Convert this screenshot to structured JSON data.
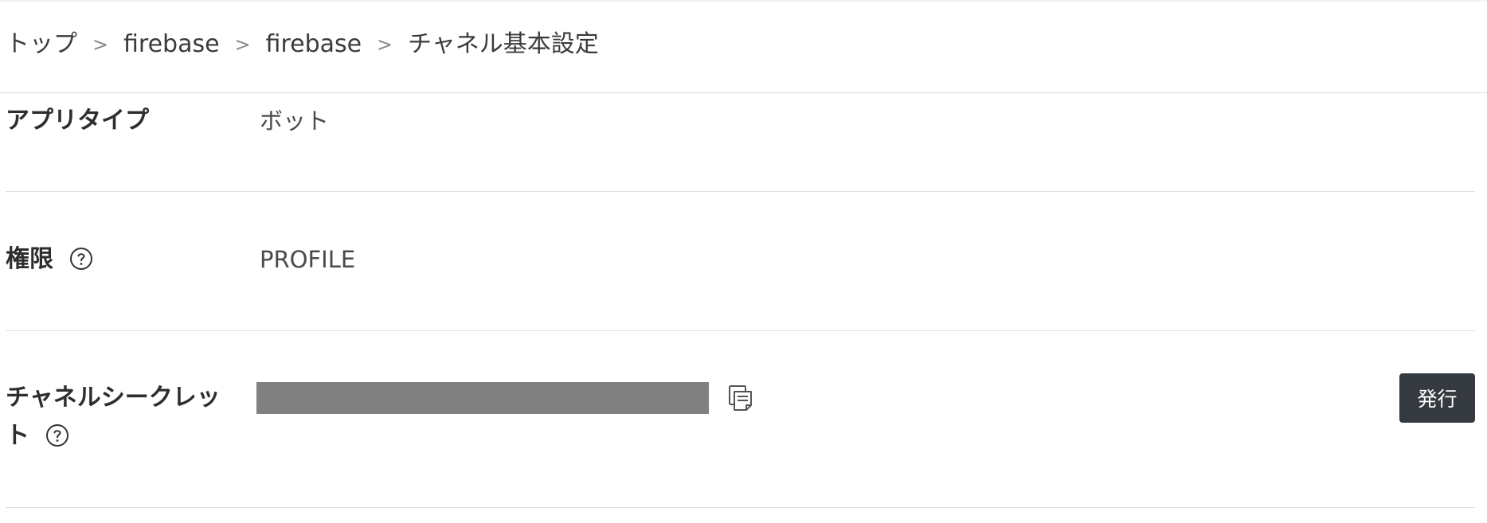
{
  "breadcrumb": {
    "items": [
      "トップ",
      "firebase",
      "firebase",
      "チャネル基本設定"
    ],
    "separator": ">"
  },
  "settings": {
    "app_type": {
      "label": "アプリタイプ",
      "value": "ボット"
    },
    "permission": {
      "label": "権限",
      "value": "PROFILE",
      "help_icon": "question-circle-icon"
    },
    "channel_secret": {
      "label_line1": "チャネルシークレッ",
      "label_line2": "ト",
      "help_icon": "question-circle-icon",
      "copy_icon": "copy-icon",
      "issue_button_label": "発行"
    }
  },
  "colors": {
    "button_bg": "#343a40",
    "masked_secret": "#808080",
    "divider": "#dedede"
  }
}
